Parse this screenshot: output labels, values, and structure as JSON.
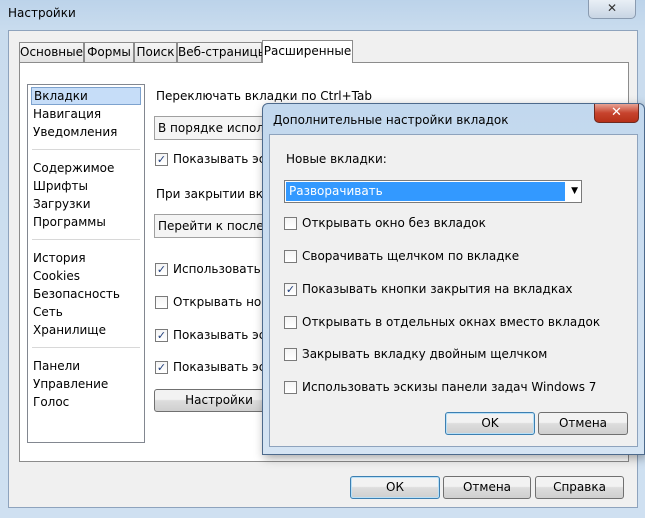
{
  "window": {
    "title": "Настройки",
    "close_glyph": "✕"
  },
  "tabs": [
    "Основные",
    "Формы",
    "Поиск",
    "Веб-страницы",
    "Расширенные"
  ],
  "categories": {
    "group1": [
      "Вкладки",
      "Навигация",
      "Уведомления"
    ],
    "group2": [
      "Содержимое",
      "Шрифты",
      "Загрузки",
      "Программы"
    ],
    "group3": [
      "История",
      "Cookies",
      "Безопасность",
      "Сеть",
      "Хранилище"
    ],
    "group4": [
      "Панели",
      "Управление",
      "Голос"
    ],
    "selected": "Вкладки"
  },
  "settings": {
    "ctrl_tab_label": "Переключать вкладки по Ctrl+Tab",
    "ctrl_tab_value": "В порядке использования",
    "show_thumbs_label": "Показывать эскизы",
    "on_close_label": "При закрытии вкладки",
    "on_close_value": "Перейти к последней",
    "use_label": "Использовать те",
    "open_new_label": "Открывать нову",
    "show_thumbs2_label": "Показывать эски",
    "show_thumbs3_label": "Показывать эски",
    "config_button": "Настройки"
  },
  "footer": {
    "ok": "ОК",
    "cancel": "Отмена",
    "help": "Справка"
  },
  "dialog": {
    "title": "Дополнительные настройки вкладок",
    "close_glyph": "✕",
    "new_tabs_label": "Новые вкладки:",
    "new_tabs_value": "Разворачивать",
    "options": [
      {
        "label": "Открывать окно без вкладок",
        "checked": false
      },
      {
        "label": "Сворачивать щелчком по вкладке",
        "checked": false
      },
      {
        "label": "Показывать кнопки закрытия на вкладках",
        "checked": true
      },
      {
        "label": "Открывать в отдельных окнах вместо вкладок",
        "checked": false
      },
      {
        "label": "Закрывать вкладку двойным щелчком",
        "checked": false
      },
      {
        "label": "Использовать эскизы панели задач Windows 7",
        "checked": false
      }
    ],
    "ok": "OK",
    "cancel": "Отмена"
  },
  "glyphs": {
    "check": "✓",
    "dropdown_arrow": "▼"
  }
}
